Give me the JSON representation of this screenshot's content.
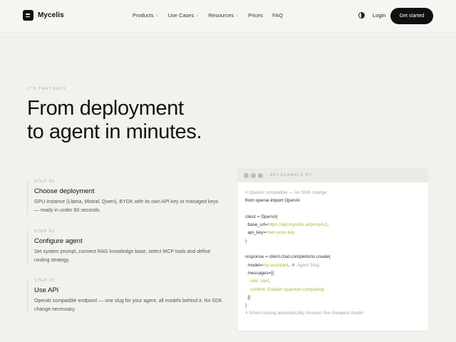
{
  "nav": {
    "brand": "Mycelis",
    "menu": [
      {
        "label": "Products",
        "caret": true
      },
      {
        "label": "Use Cases",
        "caret": true
      },
      {
        "label": "Resources",
        "caret": true
      },
      {
        "label": "Prices",
        "caret": false
      },
      {
        "label": "FAQ",
        "caret": false
      }
    ],
    "login": "Login",
    "cta": "Get started"
  },
  "hero": {
    "eyebrow": "IT'S THAT EASY",
    "title_line1": "From deployment",
    "title_line2": "to agent in minutes."
  },
  "steps": [
    {
      "num": "STEP 01",
      "title": "Choose deployment",
      "desc": "GPU instance (Llama, Mistral, Qwen), BYOK with its own API key or managed keys — ready in under 60 seconds."
    },
    {
      "num": "STEP 02",
      "title": "Configure agent",
      "desc": "Set system prompt, connect RAG knowledge base, select MCP tools and define routing strategy."
    },
    {
      "num": "STEP 03",
      "title": "Use API",
      "desc": "OpenAI compatible endpoint — one slug for your agent, all models behind it. No SDK change necessary."
    }
  ],
  "code": {
    "filename": "API-EXAMPLE.PY",
    "lines": [
      [
        {
          "t": "# OpenAI compatible — no SDK change",
          "c": "cm"
        }
      ],
      [
        {
          "t": "from",
          "c": "kw"
        },
        {
          "t": " openai ",
          "c": ""
        },
        {
          "t": "import",
          "c": "kw"
        },
        {
          "t": " OpenAI",
          "c": ""
        }
      ],
      [],
      [
        {
          "t": "client = OpenAI(",
          "c": ""
        }
      ],
      [
        {
          "t": "  base_url=",
          "c": ""
        },
        {
          "t": "https://api.mycelis.ai/proxy/v1",
          "c": "st"
        },
        {
          "t": ",",
          "c": ""
        }
      ],
      [
        {
          "t": "  api_key=",
          "c": ""
        },
        {
          "t": "mwn-your-key",
          "c": "st"
        }
      ],
      [
        {
          "t": ")",
          "c": ""
        }
      ],
      [],
      [
        {
          "t": "response = client.chat.completions.create(",
          "c": ""
        }
      ],
      [
        {
          "t": "  model=",
          "c": ""
        },
        {
          "t": "my-assistant",
          "c": "st"
        },
        {
          "t": ",  #",
          "c": ""
        },
        {
          "t": "  Agent Slug",
          "c": "cm"
        }
      ],
      [
        {
          "t": "  messages=[{",
          "c": ""
        }
      ],
      [
        {
          "t": "    role: user",
          "c": "st"
        },
        {
          "t": ",",
          "c": ""
        }
      ],
      [
        {
          "t": "    content: Explain quantum computing",
          "c": "st"
        }
      ],
      [
        {
          "t": "  }]",
          "c": ""
        }
      ],
      [
        {
          "t": ")",
          "c": ""
        }
      ],
      [
        {
          "t": "# Smart routing automatically chooses the cheapest model",
          "c": "cm"
        }
      ]
    ]
  }
}
